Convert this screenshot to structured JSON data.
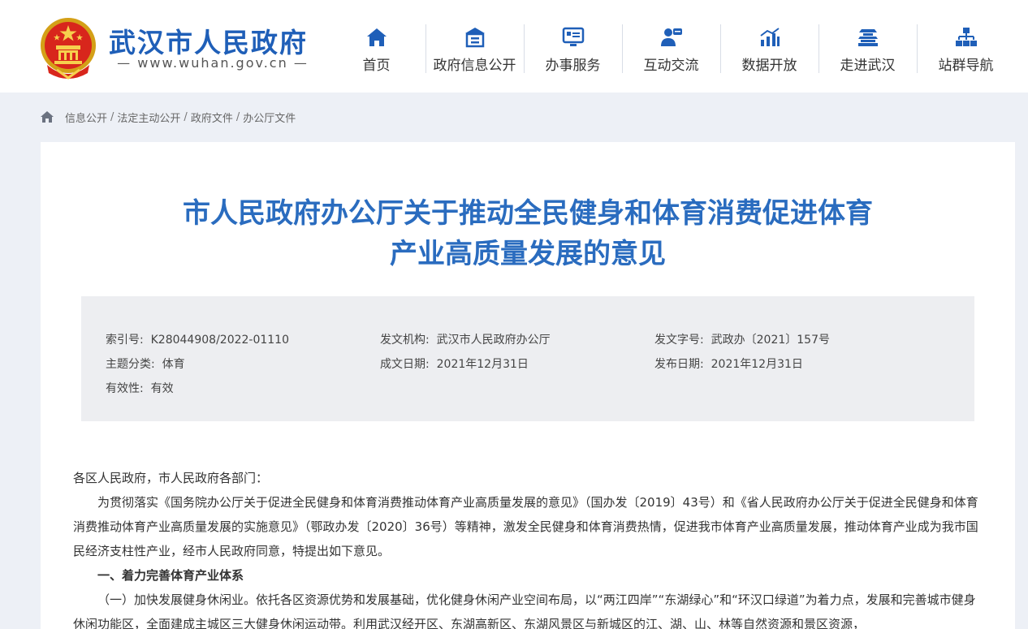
{
  "header": {
    "site_title": "武汉市人民政府",
    "site_url": "www.wuhan.gov.cn",
    "brand_color": "#1f5fb8",
    "nav": [
      {
        "label": "首页",
        "icon": "home-icon"
      },
      {
        "label": "政府信息公开",
        "icon": "info-disclosure-icon"
      },
      {
        "label": "办事服务",
        "icon": "service-icon"
      },
      {
        "label": "互动交流",
        "icon": "interaction-icon"
      },
      {
        "label": "数据开放",
        "icon": "data-open-icon"
      },
      {
        "label": "走进武汉",
        "icon": "landmark-icon"
      },
      {
        "label": "站群导航",
        "icon": "sitemap-icon"
      }
    ]
  },
  "breadcrumb": [
    "信息公开",
    "法定主动公开",
    "政府文件",
    "办公厅文件"
  ],
  "document": {
    "title_line1": "市人民政府办公厅关于推动全民健身和体育消费促进体育",
    "title_line2": "产业高质量发展的意见",
    "title_color": "#2a6cbf",
    "meta": {
      "index_label": "索引号:",
      "index_value": "K28044908/2022-01110",
      "issuer_label": "发文机构:",
      "issuer_value": "武汉市人民政府办公厅",
      "doc_no_label": "发文字号:",
      "doc_no_value": "武政办〔2021〕157号",
      "topic_label": "主题分类:",
      "topic_value": "体育",
      "created_label": "成文日期:",
      "created_value": "2021年12月31日",
      "published_label": "发布日期:",
      "published_value": "2021年12月31日",
      "validity_label": "有效性:",
      "validity_value": "有效"
    },
    "salutation": "各区人民政府，市人民政府各部门：",
    "paragraph1": "为贯彻落实《国务院办公厅关于促进全民健身和体育消费推动体育产业高质量发展的意见》（国办发〔2019〕43号）和《省人民政府办公厅关于促进全民健身和体育消费推动体育产业高质量发展的实施意见》（鄂政办发〔2020〕36号）等精神，激发全民健身和体育消费热情，促进我市体育产业高质量发展，推动体育产业成为我市国民经济支柱性产业，经市人民政府同意，特提出如下意见。",
    "section1": "一、着力完善体育产业体系",
    "paragraph2": "（一）加快发展健身休闲业。依托各区资源优势和发展基础，优化健身休闲产业空间布局，以“两江四岸”“东湖绿心”和“环汉口绿道”为着力点，发展和完善城市健身休闲功能区，全面建成主城区三大健身休闲运动带。利用武汉经开区、东湖高新区、东湖风景区与新城区的江、湖、山、林等自然资源和景区资源，"
  }
}
